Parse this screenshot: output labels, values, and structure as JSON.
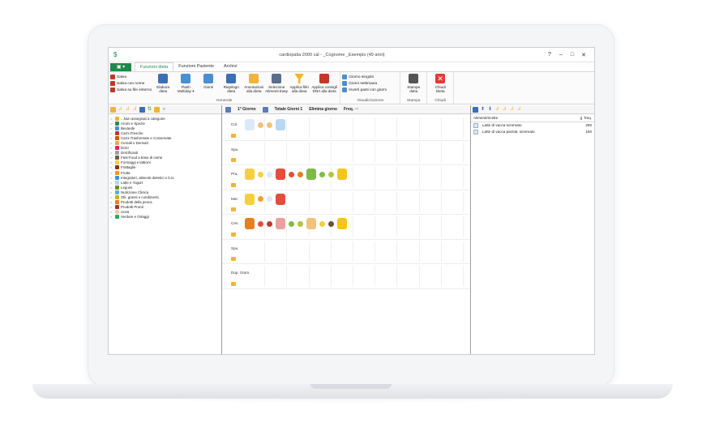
{
  "window": {
    "title": "cardiopatia 2000 cal - _Cognome _Esempio (49 anni)",
    "app_icon": "$",
    "controls": [
      "?",
      "–",
      "□",
      "✕"
    ]
  },
  "menu": {
    "file_label": "▣ ▾",
    "tabs": [
      "Funzioni dieta",
      "Funzioni Paziente",
      "Archivi"
    ]
  },
  "ribbon": {
    "save_items": [
      "Salva",
      "Salva con nome",
      "Salva su file esterno"
    ],
    "buttons": [
      {
        "label": "Elabora\ndieta",
        "color": "#3b6fb6"
      },
      {
        "label": "Flash\nMultiday ▾",
        "color": "#4a8fd0"
      },
      {
        "label": "Giorni",
        "color": "#4a8fd0"
      },
      {
        "label": "Riepilogo\ndieta",
        "color": "#3b6fb6"
      },
      {
        "label": "Annotazioni\nalla dieta",
        "color": "#f0b43a"
      },
      {
        "label": "Selezione\nAlimenti Easy",
        "color": "#5a6e8c"
      },
      {
        "label": "Applica filtri\nalla dieta",
        "color": "#f0b43a"
      },
      {
        "label": "Applica consigli\nDNA alla dieta",
        "color": "#c0392b"
      }
    ],
    "group_generale": "Generale",
    "view_items": [
      "Giorno singolo",
      "Giorni settimana",
      "Inverti pasti con giorni"
    ],
    "group_visualizzazione": "Visualizzazione",
    "print_label": "Stampa\ndieta",
    "group_stampa": "Stampa",
    "close_label": "Chiudi\nDieta",
    "group_chiudi": "Chiudi"
  },
  "tree": {
    "items": [
      {
        "label": "...Non assegnati a categorie",
        "color": "#f0b43a"
      },
      {
        "label": "Aromi e Spezie",
        "color": "#2e8b57"
      },
      {
        "label": "Bevande",
        "color": "#4a8fd0"
      },
      {
        "label": "Carni Fresche",
        "color": "#c0392b"
      },
      {
        "label": "Carni Trasformate e Conservate",
        "color": "#d35400"
      },
      {
        "label": "Cereali e Derivati",
        "color": "#e0b040"
      },
      {
        "label": "Dolci",
        "color": "#e91e63"
      },
      {
        "label": "Dolcificanti",
        "color": "#9e9e9e"
      },
      {
        "label": "Fast-Food a base di carne",
        "color": "#795548"
      },
      {
        "label": "Formaggi e latticini",
        "color": "#f4d03f"
      },
      {
        "label": "Frattaglie",
        "color": "#8e2b2b"
      },
      {
        "label": "Frutta",
        "color": "#f39c12"
      },
      {
        "label": "Integratori, alimenti dietetici e b.io",
        "color": "#3498db"
      },
      {
        "label": "Latte e Yogurt",
        "color": "#aed6f1"
      },
      {
        "label": "Legumi",
        "color": "#6b8e23"
      },
      {
        "label": "Nutrizione Clinica",
        "color": "#5dade2"
      },
      {
        "label": "Olii, grassi e condimenti",
        "color": "#d4ac0d"
      },
      {
        "label": "Prodotti della pesca",
        "color": "#e67e22"
      },
      {
        "label": "Prodotti Pronti",
        "color": "#a93226"
      },
      {
        "label": "Uova",
        "color": "#f5cba7"
      },
      {
        "label": "Verdure e Ortaggi",
        "color": "#27ae60"
      }
    ]
  },
  "diet": {
    "day_label": "1° Giorno",
    "total_label": "Totale Giorni 1",
    "delete_label": "Elimina giorno",
    "freq_label": "Freq. ···",
    "meals": [
      {
        "label": "Col.",
        "foods": [
          "#dbe9f7",
          "#f0c27b",
          "#f0c27b",
          "#b9d7f0"
        ]
      },
      {
        "label": "Spu.",
        "foods": []
      },
      {
        "label": "Pra.",
        "foods": [
          "#f4d03f",
          "#f4d03f",
          "#dbe9f7",
          "#e74c3c",
          "#e74c3c",
          "#e67e22",
          "#7dbb45",
          "#7dbb45",
          "#b5c43a",
          "#f5c518"
        ]
      },
      {
        "label": "Mer.",
        "foods": [
          "#f4d03f",
          "#f0a030",
          "#dbe9f7",
          "#e74c3c"
        ]
      },
      {
        "label": "Cen.",
        "foods": [
          "#e67e22",
          "#e74c3c",
          "#c0392b",
          "#e8a0a0",
          "#7dbb45",
          "#b5c43a",
          "#f0c27b",
          "#f4d03f",
          "#6d4c41",
          "#f5c518"
        ]
      },
      {
        "label": "Spu.",
        "foods": []
      },
      {
        "label": "Dop. Giorn.",
        "foods": []
      }
    ]
  },
  "recipes": {
    "header_name": "Alimenti/ricette",
    "header_g": "g",
    "header_freq": "freq.",
    "rows": [
      {
        "name": "Latte di vacca scremato",
        "g": "200"
      },
      {
        "name": "Latte di vacca parzial. scremato",
        "g": "150"
      }
    ]
  }
}
